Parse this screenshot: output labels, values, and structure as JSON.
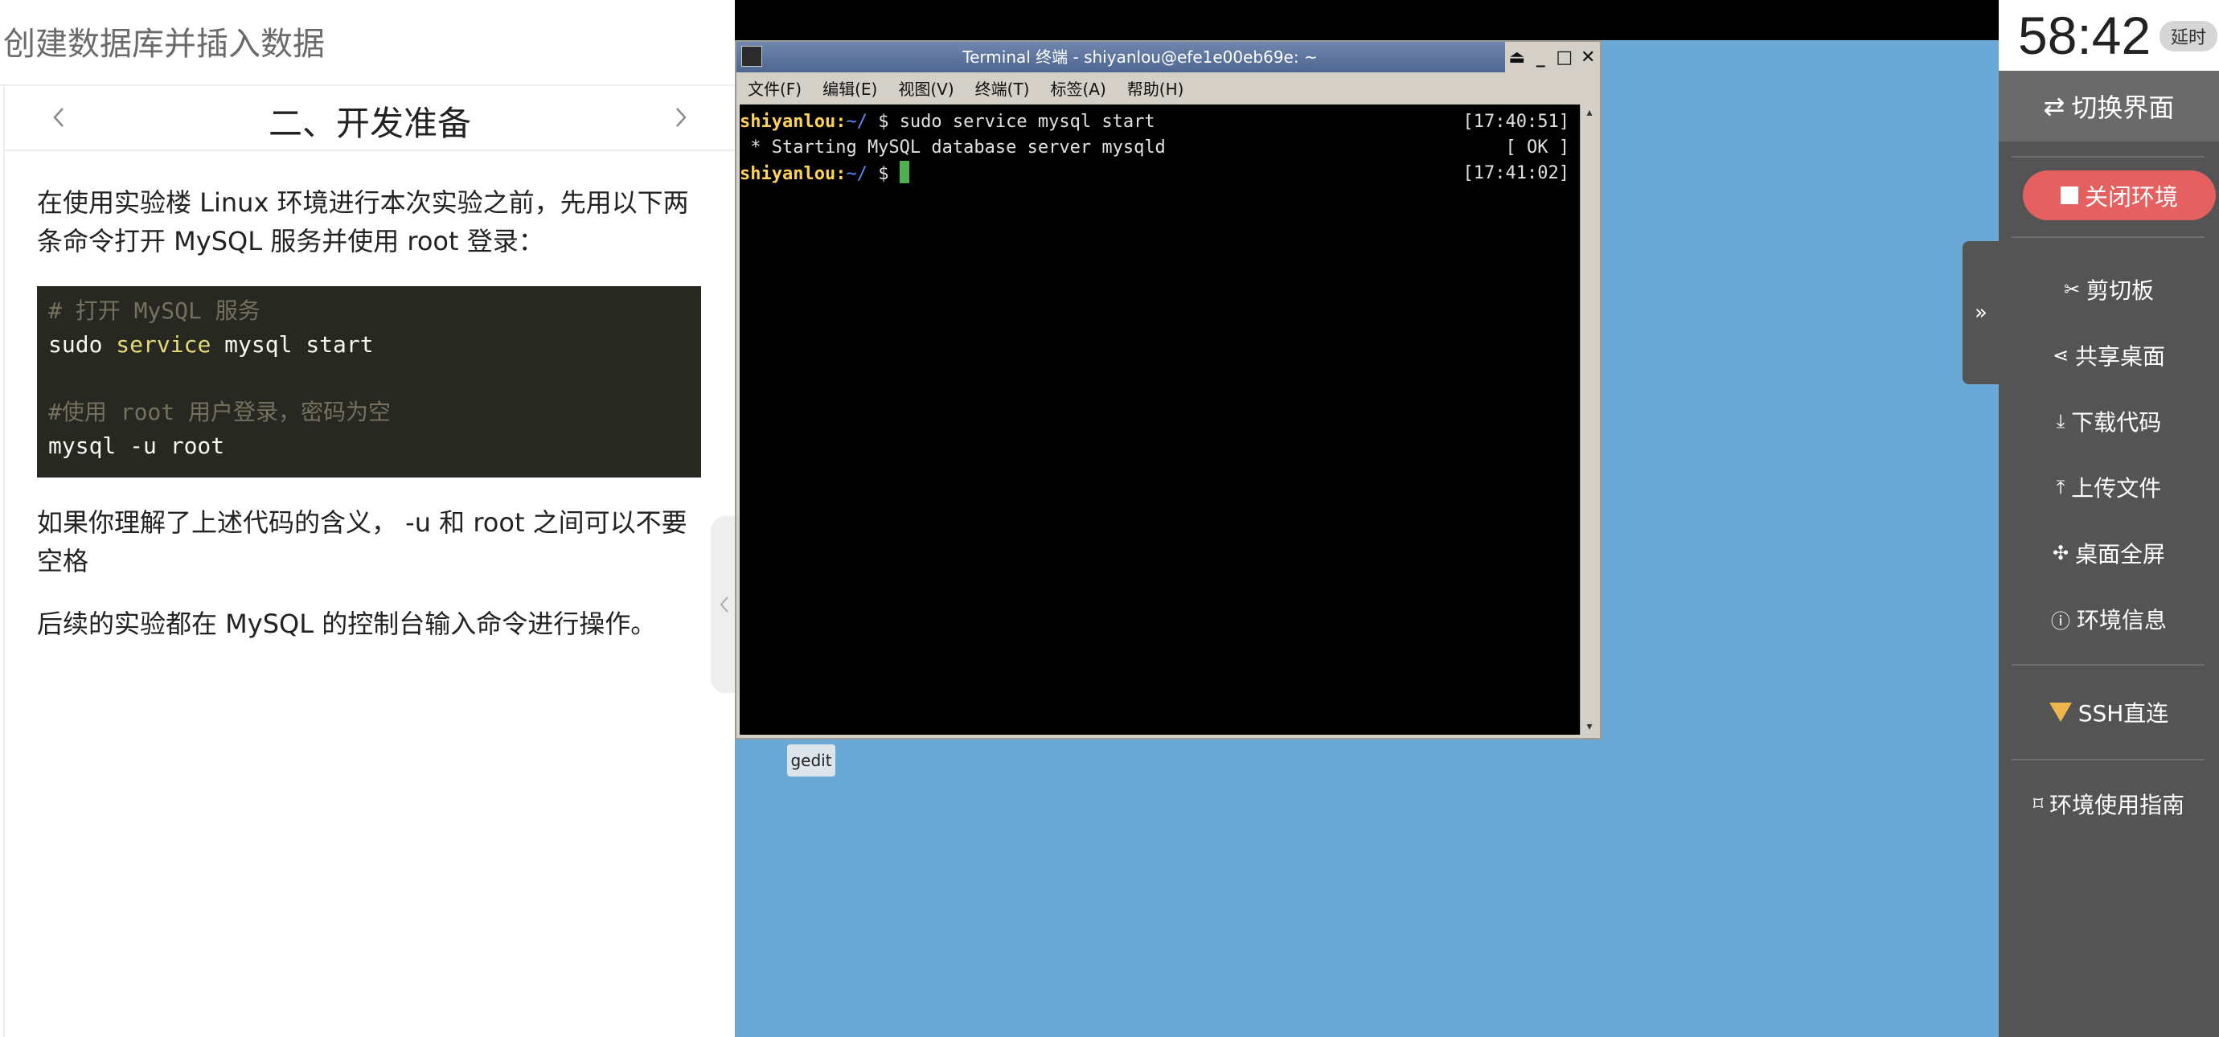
{
  "doc": {
    "page_title": "创建数据库并插入数据",
    "section_title": "二、开发准备",
    "intro": "在使用实验楼 Linux 环境进行本次实验之前，先用以下两条命令打开 MySQL 服务并使用 root 登录：",
    "code_lines": [
      {
        "comment": "# 打开 MySQL 服务"
      },
      {
        "cmd": "sudo ",
        "kw": "service",
        "rest": " mysql start"
      },
      {
        "blank": ""
      },
      {
        "comment": "#使用 root 用户登录，密码为空"
      },
      {
        "cmd": "mysql -u root"
      }
    ],
    "note": "如果你理解了上述代码的含义， -u 和 root 之间可以不要空格",
    "followup": "后续的实验都在 MySQL 的控制台输入命令进行操作。"
  },
  "terminal": {
    "title": "Terminal 终端 - shiyanlou@efe1e00eb69e: ~",
    "menu": [
      "文件(F)",
      "编辑(E)",
      "视图(V)",
      "终端(T)",
      "标签(A)",
      "帮助(H)"
    ],
    "lines": [
      {
        "user": "shiyanlou:",
        "path": "~/",
        "cmd": " $ sudo service mysql start",
        "time": "[17:40:51]"
      },
      {
        "text": " * Starting MySQL database server mysqld",
        "time": "[ OK ]"
      },
      {
        "user": "shiyanlou:",
        "path": "~/",
        "cmd": " $ ",
        "time": "[17:41:02]"
      }
    ]
  },
  "desktop": {
    "gedit_label": "gedit"
  },
  "panel": {
    "timer": "58:42",
    "extend": "延时",
    "switch_label": "切换界面",
    "close_label": "关闭环境",
    "tools": [
      "剪切板",
      "共享桌面",
      "下载代码",
      "上传文件",
      "桌面全屏",
      "环境信息"
    ],
    "ssh_label": "SSH直连",
    "guide_label": "环境使用指南"
  },
  "colors": {
    "desktop_bg": "#6aa8d5",
    "panel_bg": "#545454",
    "close_btn": "#e56060",
    "prompt_user": "#ffd25a",
    "prompt_path": "#5a8cff"
  }
}
